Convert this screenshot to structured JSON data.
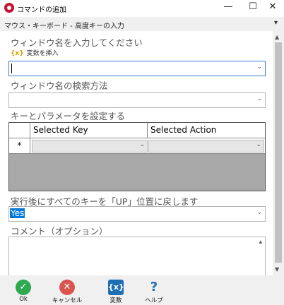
{
  "window": {
    "title": "コマンドの追加",
    "minimize": "—",
    "maximize": "☐",
    "close": "✕"
  },
  "category": {
    "text": "マウス・キーボード - 高度キーの入力"
  },
  "form": {
    "window_name_label": "ウィンドウ名を入力してください",
    "insert_variable": "変数を挿入",
    "insert_variable_brace": "{x}",
    "window_name_value": "",
    "search_method_label": "ウィンドウ名の検索方法",
    "search_method_value": "",
    "keys_label": "キーとパラメータを設定する",
    "grid": {
      "columns": [
        "Selected Key",
        "Selected Action"
      ],
      "new_row_marker": "*"
    },
    "reset_label": "実行後にすべてのキーを「UP」位置に戻します",
    "reset_value": "Yes",
    "comment_label": "コメント（オプション）",
    "comment_value": ""
  },
  "footer": {
    "ok": "Ok",
    "cancel": "キャンセル",
    "variables": "変数",
    "help": "ヘルプ"
  },
  "icons": {
    "app": "app-icon",
    "ok": "check-circle-icon",
    "cancel": "x-circle-icon",
    "variables": "variable-braces-icon",
    "help": "question-mark-icon"
  },
  "colors": {
    "ok": "#2fa84f",
    "cancel": "#d9534f",
    "accent": "#1f6fb5",
    "selection": "#0078d7"
  }
}
